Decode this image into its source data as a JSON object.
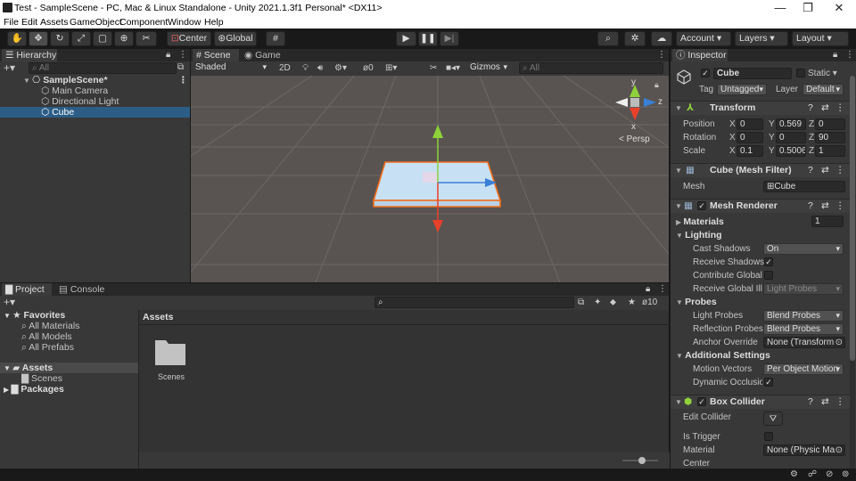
{
  "window": {
    "title": "Test - SampleScene - PC, Mac & Linux Standalone - Unity 2021.1.3f1 Personal* <DX11>",
    "controls": [
      "—",
      "❐",
      "✕"
    ]
  },
  "menu": [
    "File",
    "Edit",
    "Assets",
    "GameObject",
    "Component",
    "Window",
    "Help"
  ],
  "toolbar": {
    "pivot": "Center",
    "space": "Global",
    "account": "Account",
    "layers": "Layers",
    "layout": "Layout"
  },
  "hierarchy": {
    "tab": "Hierarchy",
    "search_placeholder": "All",
    "scene": "SampleScene*",
    "items": [
      "Main Camera",
      "Directional Light",
      "Cube"
    ],
    "selected": "Cube"
  },
  "scene_view": {
    "tabs": [
      "Scene",
      "Game"
    ],
    "draw_mode": "Shaded",
    "two_d": "2D",
    "hidden_count": "0",
    "gizmos": "Gizmos",
    "search_placeholder": "All",
    "persp": "Persp",
    "axis_y": "y",
    "axis_x": "x",
    "axis_z": "z"
  },
  "project": {
    "tabs": [
      "Project",
      "Console"
    ],
    "favorites_label": "Favorites",
    "favorites": [
      "All Materials",
      "All Models",
      "All Prefabs"
    ],
    "assets_label": "Assets",
    "asset_children": [
      "Scenes"
    ],
    "packages_label": "Packages",
    "breadcrumb": "Assets",
    "folder": "Scenes",
    "hidden_count": "10"
  },
  "inspector": {
    "tab": "Inspector",
    "object_name": "Cube",
    "static_label": "Static",
    "tag_label": "Tag",
    "tag_value": "Untagged",
    "layer_label": "Layer",
    "layer_value": "Default",
    "transform": {
      "title": "Transform",
      "position": {
        "label": "Position",
        "x": "0",
        "y": "0.569",
        "z": "0"
      },
      "rotation": {
        "label": "Rotation",
        "x": "0",
        "y": "0",
        "z": "90"
      },
      "scale": {
        "label": "Scale",
        "x": "0.1",
        "y": "0.5006",
        "z": "1"
      }
    },
    "mesh_filter": {
      "title": "Cube (Mesh Filter)",
      "mesh_label": "Mesh",
      "mesh_value": "Cube"
    },
    "mesh_renderer": {
      "title": "Mesh Renderer",
      "materials_label": "Materials",
      "materials_count": "1",
      "lighting_label": "Lighting",
      "cast_shadows_label": "Cast Shadows",
      "cast_shadows_value": "On",
      "receive_shadows_label": "Receive Shadows",
      "contribute_gi_label": "Contribute Global",
      "receive_gi_label": "Receive Global Illu",
      "receive_gi_value": "Light Probes",
      "probes_label": "Probes",
      "light_probes_label": "Light Probes",
      "light_probes_value": "Blend Probes",
      "reflection_probes_label": "Reflection Probes",
      "reflection_probes_value": "Blend Probes",
      "anchor_override_label": "Anchor Override",
      "anchor_override_value": "None (Transform",
      "additional_label": "Additional Settings",
      "motion_vectors_label": "Motion Vectors",
      "motion_vectors_value": "Per Object Motion",
      "dynamic_occlusion_label": "Dynamic Occlusio"
    },
    "box_collider": {
      "title": "Box Collider",
      "edit_collider_label": "Edit Collider",
      "is_trigger_label": "Is Trigger",
      "material_label": "Material",
      "material_value": "None (Physic Ma",
      "center_label": "Center"
    }
  },
  "colors": {
    "selection": "#2c5d87",
    "panel": "#383838",
    "scene_bg": "#595451",
    "cube_face": "#c7e0f4",
    "outline": "#f26d1a"
  }
}
